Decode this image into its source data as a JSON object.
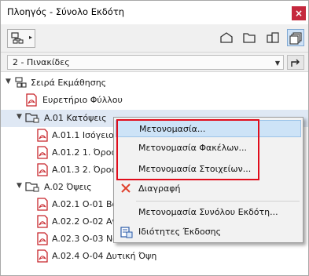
{
  "window": {
    "title": "Πλοηγός - Σύνολο Εκδότη",
    "close_label": "×"
  },
  "toolbar": {
    "left_button_arrow": "▸",
    "icons": [
      "project-map-icon",
      "view-map-icon",
      "layout-book-icon",
      "publisher-sets-icon"
    ],
    "active_icon": "publisher-sets-icon"
  },
  "selector": {
    "value": "2 - Πινακίδες",
    "dropdown_arrow": "▼"
  },
  "tree": {
    "root": {
      "label": "Σειρά Εκμάθησης",
      "toggle": "▼"
    },
    "items": [
      {
        "label": "Ευρετήριο Φύλλου",
        "type": "pdf"
      },
      {
        "label": "A.01 Κατόψεις",
        "type": "folder",
        "toggle": "▼",
        "selected": true
      },
      {
        "label": "A.01.1 Ισόγειο",
        "type": "pdf"
      },
      {
        "label": "A.01.2 1. Όροφ",
        "type": "pdf"
      },
      {
        "label": "A.01.3 2. Όροφ",
        "type": "pdf"
      },
      {
        "label": "A.02 Όψεις",
        "type": "folder",
        "toggle": "▼"
      },
      {
        "label": "A.02.1 Ο-01 Βόρ",
        "type": "pdf"
      },
      {
        "label": "A.02.2 Ο-02 Ανα",
        "type": "pdf"
      },
      {
        "label": "A.02.3 Ο-03 Νότ",
        "type": "pdf"
      },
      {
        "label": "A.02.4 Ο-04 Δυτική Όψη",
        "type": "pdf"
      }
    ]
  },
  "context_menu": {
    "items": [
      {
        "label": "Μετονομασία...",
        "highlighted": true
      },
      {
        "label": "Μετονομασία Φακέλων..."
      },
      {
        "label": "Μετονομασία Στοιχείων..."
      },
      {
        "label": "Διαγραφή",
        "icon": "delete-x-icon"
      },
      {
        "label": "Μετονομασία Συνόλου Εκδότη..."
      },
      {
        "label": "Ιδιότητες Έκδοσης",
        "icon": "publish-properties-icon"
      }
    ]
  },
  "colors": {
    "highlight": "#cde3f7",
    "annotation_box": "#e00d1c",
    "pdf_red": "#c8252b",
    "delete_red": "#e0402c"
  }
}
